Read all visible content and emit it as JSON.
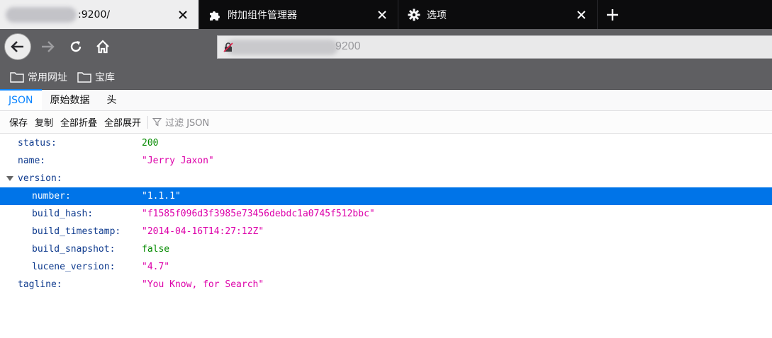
{
  "tabs": [
    {
      "title": ":9200/",
      "active": true,
      "icon": "blurred-favicon"
    },
    {
      "title": "附加组件管理器",
      "active": false,
      "icon": "puzzle-icon"
    },
    {
      "title": "选项",
      "active": false,
      "icon": "gear-icon"
    }
  ],
  "toolbar": {
    "url_suffix": "9200"
  },
  "bookmarks": [
    {
      "label": "常用网址",
      "icon": "folder-icon"
    },
    {
      "label": "宝库",
      "icon": "folder-icon"
    }
  ],
  "viewer_tabs": [
    {
      "label": "JSON",
      "active": true
    },
    {
      "label": "原始数据",
      "active": false
    },
    {
      "label": "头",
      "active": false
    }
  ],
  "viewer_toolbar": {
    "save": "保存",
    "copy": "复制",
    "collapse_all": "全部折叠",
    "expand_all": "全部展开",
    "filter_placeholder": "过滤 JSON"
  },
  "json_rows": [
    {
      "key": "status:",
      "value": "200",
      "type": "num",
      "depth": 0
    },
    {
      "key": "name:",
      "value": "\"Jerry Jaxon\"",
      "type": "str",
      "depth": 0
    },
    {
      "key": "version:",
      "value": "",
      "type": "obj",
      "depth": 0,
      "expanded": true
    },
    {
      "key": "number:",
      "value": "\"1.1.1\"",
      "type": "str",
      "depth": 1,
      "selected": true
    },
    {
      "key": "build_hash:",
      "value": "\"f1585f096d3f3985e73456debdc1a0745f512bbc\"",
      "type": "str",
      "depth": 1
    },
    {
      "key": "build_timestamp:",
      "value": "\"2014-04-16T14:27:12Z\"",
      "type": "str",
      "depth": 1
    },
    {
      "key": "build_snapshot:",
      "value": "false",
      "type": "bool",
      "depth": 1
    },
    {
      "key": "lucene_version:",
      "value": "\"4.7\"",
      "type": "str",
      "depth": 1
    },
    {
      "key": "tagline:",
      "value": "\"You Know, for Search\"",
      "type": "str",
      "depth": 0
    }
  ],
  "colors": {
    "accent": "#0a84ff",
    "selection": "#0074e8",
    "key": "#0f3b8e",
    "string": "#dd00a9",
    "number": "#058b00"
  }
}
